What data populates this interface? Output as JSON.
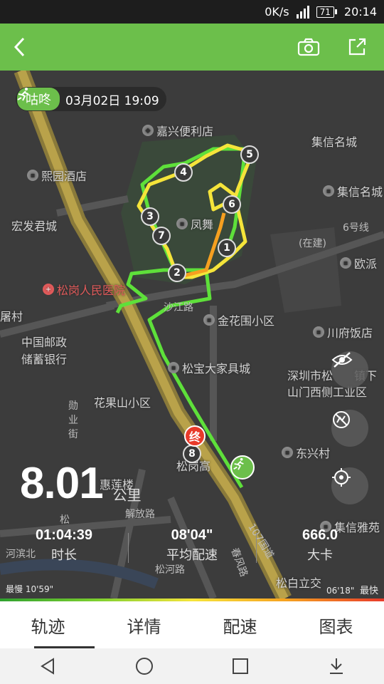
{
  "status_bar": {
    "net_speed": "0K/s",
    "signal_label": "1",
    "battery": "71",
    "time": "20:14"
  },
  "appbar": {
    "back_icon": "chevron-left-icon",
    "camera_icon": "camera-icon",
    "share_icon": "share-icon"
  },
  "run": {
    "app_logo": "咕咚",
    "date": "03月02日 19:09",
    "activity_icon": "running-icon",
    "distance": "8.01",
    "distance_unit": "公里",
    "duration": "01:04:39",
    "duration_label": "时长",
    "avg_pace": "08'04\"",
    "avg_pace_label": "平均配速",
    "calories": "666.0",
    "calories_label": "大卡"
  },
  "pace_legend": {
    "slowest_label": "最慢",
    "slowest_value": "10'59\"",
    "fastest_value": "06'18\"",
    "fastest_label": "最快"
  },
  "map": {
    "pois": {
      "jiaxing": "嘉兴便利店",
      "jixin": "集信名城",
      "jixin2": "集信名城",
      "xiyuan": "熙园酒店",
      "hongfa": "宏发君城",
      "fengwu": "凤舞",
      "oupai": "欧派",
      "songgang_hospital": "松岗人民医院",
      "village": "屠村",
      "jinhuawei": "金花围小区",
      "chuanfu": "川府饭店",
      "post1": "中国邮政",
      "post2": "储蓄银行",
      "songbao": "松宝大家具城",
      "shenzhen1": "深圳市松",
      "shenzhen2": "镇下",
      "shanmen": "山门西侧工业区",
      "huaguoshan": "花果山小区",
      "dongxing": "东兴村",
      "songgang_gao": "松岗高",
      "huilou": "惠莲楼",
      "jixin_ya": "集信雅苑",
      "songbai": "松白立交"
    },
    "roads": {
      "zaijian": "(在建)",
      "line6": "6号线",
      "shajiang": "沙江路",
      "jiefang": "解放路",
      "song": "松",
      "hebin": "河滨北",
      "xunye": "勋业街",
      "guodao": "107国道",
      "chunfeng": "春风路",
      "songhe": "松河路"
    },
    "markers": [
      "1",
      "2",
      "3",
      "4",
      "5",
      "6",
      "7",
      "8"
    ],
    "end_label": "终",
    "fab_icons": [
      "eye-off-icon",
      "layers-off-icon",
      "locate-icon"
    ]
  },
  "tabs": [
    {
      "label": "轨迹",
      "active": true
    },
    {
      "label": "详情",
      "active": false
    },
    {
      "label": "配速",
      "active": false
    },
    {
      "label": "图表",
      "active": false
    }
  ],
  "colors": {
    "brand_green": "#6cbf4b",
    "track_green": "#5ee03a",
    "track_yellow": "#f5e43a",
    "track_orange": "#f5a020",
    "end_red": "#e83a2a"
  }
}
